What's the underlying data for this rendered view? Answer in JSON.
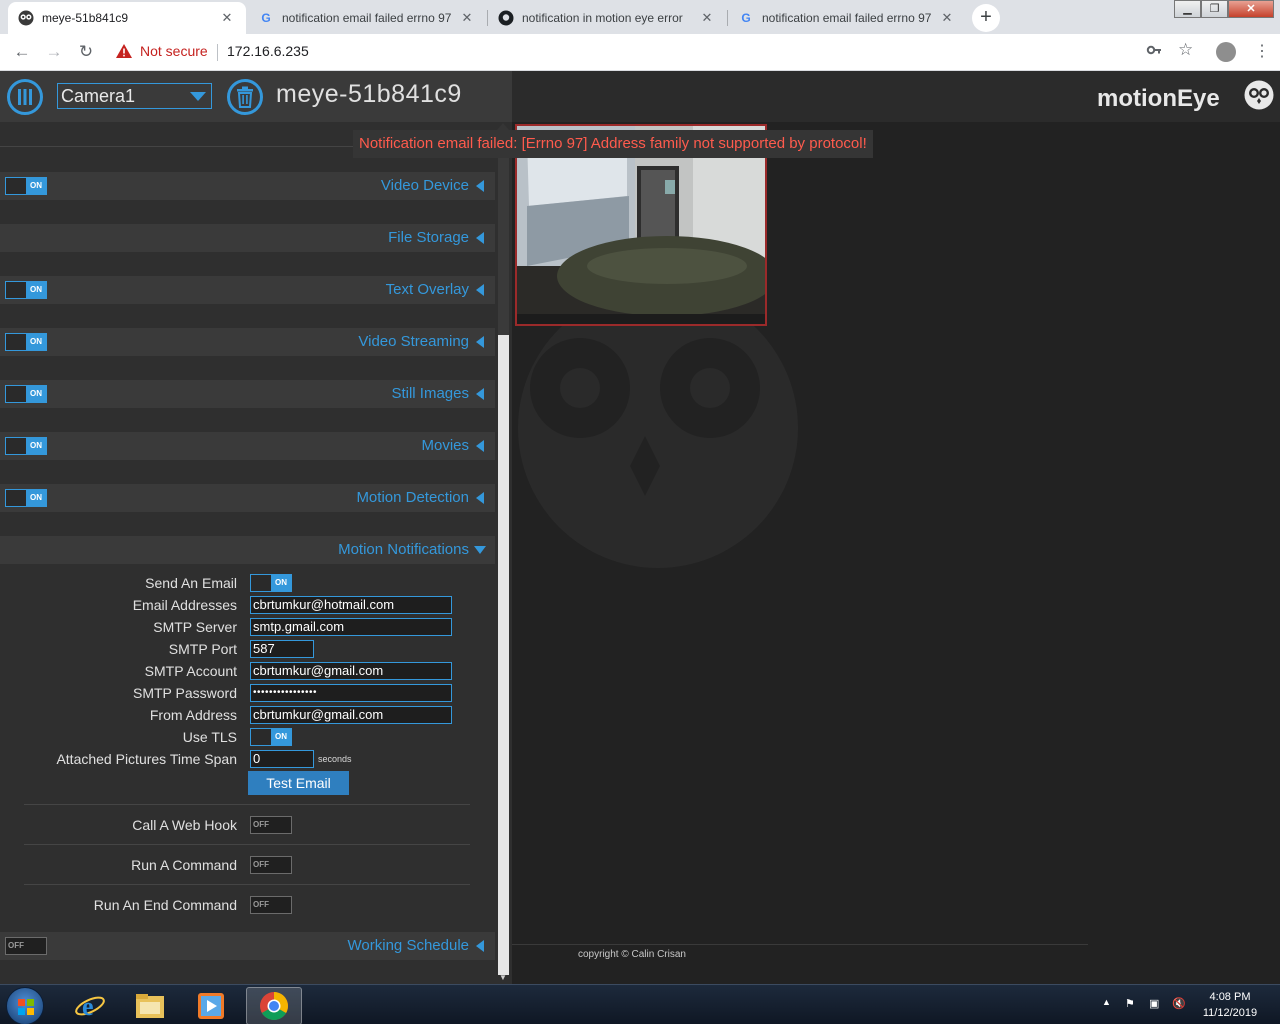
{
  "browser": {
    "tabs": [
      {
        "title": "meye-51b841c9",
        "favicon": "motioneye-owl-icon",
        "active": true
      },
      {
        "title": "notification email failed errno 97",
        "favicon": "google-icon",
        "active": false
      },
      {
        "title": "notification in motion eye error",
        "favicon": "github-icon",
        "active": false
      },
      {
        "title": "notification email failed errno 97",
        "favicon": "google-icon",
        "active": false
      }
    ],
    "security_label": "Not secure",
    "url": "172.16.6.235"
  },
  "header": {
    "camera_selected": "Camera1",
    "device_name": "meye-51b841c9",
    "brand": "motionEye",
    "accent": "#3498db"
  },
  "notification": {
    "message": "Notification email failed: [Errno 97] Address family not supported by protocol!",
    "color": "#ff5b4d"
  },
  "sections": {
    "video_device": {
      "label": "Video Device",
      "toggle": "ON"
    },
    "file_storage": {
      "label": "File Storage"
    },
    "text_overlay": {
      "label": "Text Overlay",
      "toggle": "ON"
    },
    "video_streaming": {
      "label": "Video Streaming",
      "toggle": "ON"
    },
    "still_images": {
      "label": "Still Images",
      "toggle": "ON"
    },
    "movies": {
      "label": "Movies",
      "toggle": "ON"
    },
    "motion_detection": {
      "label": "Motion Detection",
      "toggle": "ON"
    },
    "motion_notifications": {
      "label": "Motion Notifications"
    },
    "working_schedule": {
      "label": "Working Schedule",
      "toggle": "OFF"
    }
  },
  "notifications_form": {
    "send_email": {
      "label": "Send An Email",
      "toggle": "ON"
    },
    "email_addresses": {
      "label": "Email Addresses",
      "value": "cbrtumkur@hotmail.com"
    },
    "smtp_server": {
      "label": "SMTP Server",
      "value": "smtp.gmail.com"
    },
    "smtp_port": {
      "label": "SMTP Port",
      "value": "587"
    },
    "smtp_account": {
      "label": "SMTP Account",
      "value": "cbrtumkur@gmail.com"
    },
    "smtp_password": {
      "label": "SMTP Password",
      "value": "••••••••••••••••"
    },
    "from_address": {
      "label": "From Address",
      "value": "cbrtumkur@gmail.com"
    },
    "use_tls": {
      "label": "Use TLS",
      "toggle": "ON"
    },
    "attached_time_span": {
      "label": "Attached Pictures Time Span",
      "value": "0",
      "unit": "seconds"
    },
    "test_email_label": "Test Email",
    "web_hook": {
      "label": "Call A Web Hook",
      "toggle": "OFF"
    },
    "run_command": {
      "label": "Run A Command",
      "toggle": "OFF"
    },
    "run_end_command": {
      "label": "Run An End Command",
      "toggle": "OFF"
    }
  },
  "footer": {
    "copyright": "copyright © Calin Crisan"
  },
  "taskbar": {
    "time": "4:08 PM",
    "date": "11/12/2019"
  }
}
